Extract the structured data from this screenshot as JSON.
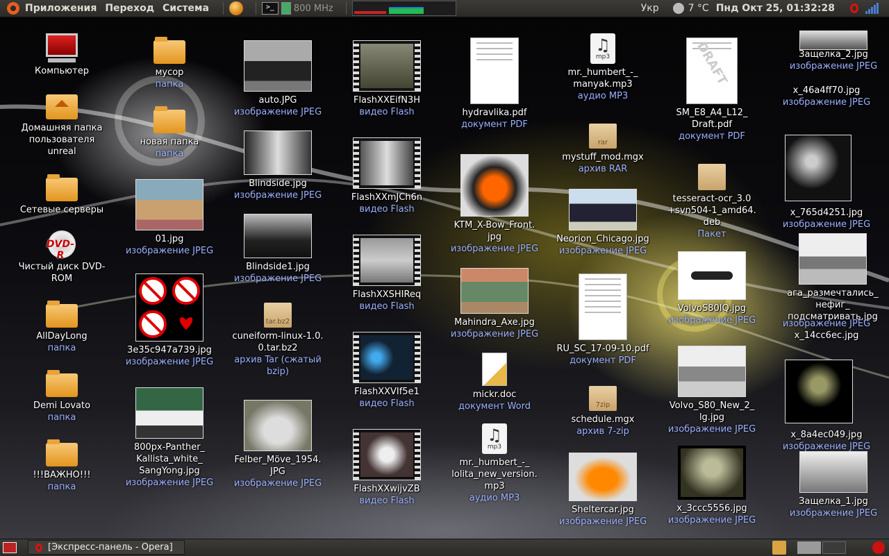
{
  "top_panel": {
    "menus": [
      "Приложения",
      "Переход",
      "Система"
    ],
    "cpu_freq": "800 MHz",
    "terminal_glyph": ">_",
    "keyboard_layout": "Укр",
    "temperature": "7 °C",
    "clock": "Пнд Окт 25, 01:32:28"
  },
  "bottom_panel": {
    "task": "[Экспресс-панель - Opera]"
  },
  "desktop": {
    "computer": "Компьютер",
    "home": "Домашняя папка пользователя unreal",
    "network": "Сетевые серверы",
    "dvd": "Чистый диск DVD-ROM",
    "dvd_logo": "DVD-R",
    "alldaylong": {
      "name": "AllDayLong",
      "type": "папка"
    },
    "demi": {
      "name": "Demi Lovato",
      "type": "папка"
    },
    "vazhno": {
      "name": "!!!ВАЖНО!!!",
      "type": "папка"
    },
    "musor": {
      "name": "мусор",
      "type": "папка"
    },
    "newfolder": {
      "name": "новая папка",
      "type": "папка"
    },
    "f01": {
      "name": "01.jpg",
      "type": "изображение JPEG"
    },
    "f3e35": {
      "name": "3e35c947a739.jpg",
      "type": "изображение JPEG"
    },
    "panther": {
      "name": "800px-Panther_ Kallista_white_ SangYong.jpg",
      "type": "изображение JPEG"
    },
    "auto": {
      "name": "auto.JPG",
      "type": "изображение JPEG"
    },
    "blindside": {
      "name": "Blindside.jpg",
      "type": "изображение JPEG"
    },
    "blindside1": {
      "name": "Blindside1.jpg",
      "type": "изображение JPEG"
    },
    "cuneiform": {
      "name": "cuneiform-linux-1.0. 0.tar.bz2",
      "type": "архив Tar (сжатый bzip)",
      "ext": "tar.bz2"
    },
    "felber": {
      "name": "Felber_Möve_1954. JPG",
      "type": "изображение JPEG"
    },
    "flash1": {
      "name": "FlashXXEifN3H",
      "type": "видео Flash"
    },
    "flash2": {
      "name": "FlashXXmJCh6n",
      "type": "видео Flash"
    },
    "flash3": {
      "name": "FlashXXSHIReq",
      "type": "видео Flash"
    },
    "flash4": {
      "name": "FlashXXVIf5e1",
      "type": "видео Flash"
    },
    "flash5": {
      "name": "FlashXXwijvZB",
      "type": "видео Flash"
    },
    "hydravlika": {
      "name": "hydravlika.pdf",
      "type": "документ PDF"
    },
    "ktm": {
      "name": "KTM_X-Bow_Front. jpg",
      "type": "изображение JPEG"
    },
    "mahindra": {
      "name": "Mahindra_Axe.jpg",
      "type": "изображение JPEG"
    },
    "mickr": {
      "name": "mickr.doc",
      "type": "документ Word"
    },
    "lolita": {
      "name": "mr._humbert_-_ lolita_new_version. mp3",
      "type": "аудио MP3",
      "ext": "mp3"
    },
    "manyak": {
      "name": "mr._humbert_-_ manyak.mp3",
      "type": "аудио MP3",
      "ext": "mp3"
    },
    "mystuff": {
      "name": "mystuff_mod.mgx",
      "type": "архив RAR",
      "ext": "rar"
    },
    "neorion": {
      "name": "Neorion_Chicago.jpg",
      "type": "изображение JPEG"
    },
    "rusc": {
      "name": "RU_SC_17-09-10.pdf",
      "type": "документ PDF"
    },
    "schedule": {
      "name": "schedule.mgx",
      "type": "архив 7-zip",
      "ext": "7zip"
    },
    "sheltercar": {
      "name": "Sheltercar.jpg",
      "type": "изображение JPEG"
    },
    "sm": {
      "name": "SM_E8_A4_L12_ Draft.pdf",
      "type": "документ PDF",
      "stamp": "DRAFT"
    },
    "tesseract": {
      "name": "tesseract-ocr_3.0 +svn504-1_amd64. deb",
      "type": "Пакет"
    },
    "volvo1": {
      "name": "VolvoS80IQ.jpg",
      "type": "изображение JPEG"
    },
    "volvo2": {
      "name": "Volvo_S80_New_2_ lg.jpg",
      "type": "изображение JPEG"
    },
    "x3ccc": {
      "name": "x_3ccc5556.jpg",
      "type": "изображение JPEG"
    },
    "zashelka2": {
      "name": "Защелка_2.jpg",
      "type": "изображение JPEG"
    },
    "x46a": {
      "name": "x_46a4ff70.jpg",
      "type": "изображение JPEG"
    },
    "x765": {
      "name": "x_765d4251.jpg",
      "type": "изображение JPEG"
    },
    "aga": {
      "name": "ага_размечтались_ нефиг_ подсматривать.jpg",
      "type": "изображение JPEG"
    },
    "x14": {
      "name": "x_14сс6ес.jpg",
      "type": "изображение JPEG"
    },
    "x8a": {
      "name": "x_8a4ec049.jpg",
      "type": "изображение JPEG"
    },
    "zashelka1": {
      "name": "Защелка_1.jpg",
      "type": "изображение JPEG"
    }
  }
}
